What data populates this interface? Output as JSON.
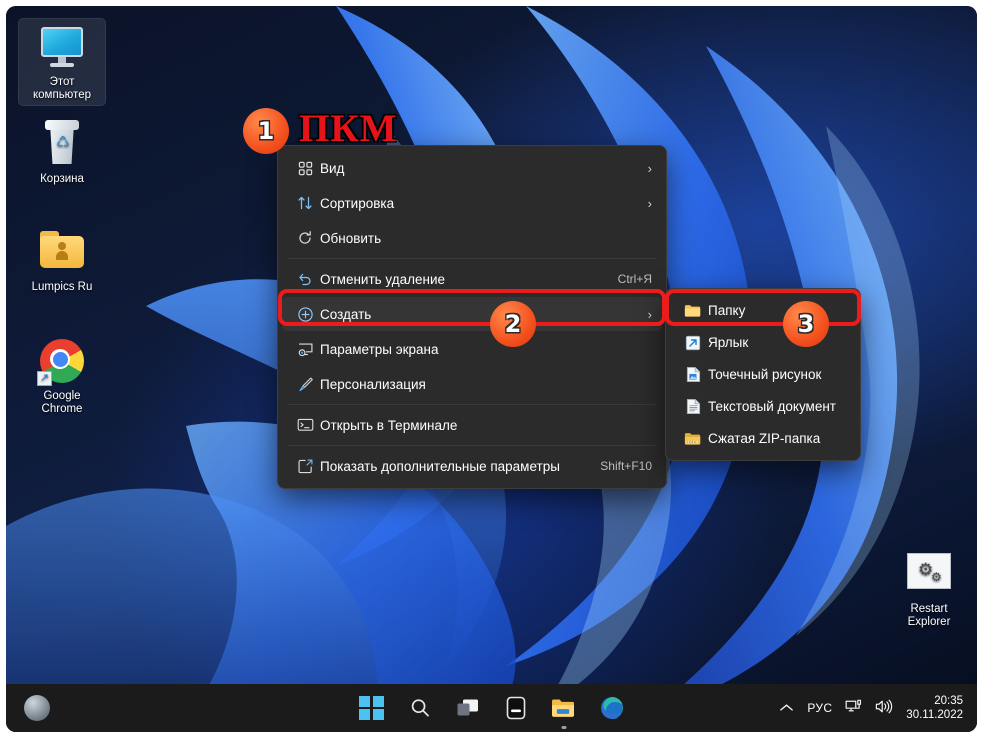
{
  "desktop": {
    "icons": [
      {
        "name": "this-pc",
        "label": "Этот\nкомпьютер",
        "selected": true
      },
      {
        "name": "recycle-bin",
        "label": "Корзина",
        "selected": false
      },
      {
        "name": "lumpics-folder",
        "label": "Lumpics Ru",
        "selected": false
      },
      {
        "name": "google-chrome",
        "label": "Google\nChrome",
        "selected": false
      },
      {
        "name": "restart-explorer",
        "label": "Restart\nExplorer",
        "selected": false
      }
    ]
  },
  "annotation": {
    "action_label": "ПКМ",
    "badge1": "1",
    "badge2": "2",
    "badge3": "3",
    "highlight_color": "#ec1c1c",
    "badge_color": "#f4511e"
  },
  "context_menu": {
    "items": [
      {
        "icon": "grid-view-icon",
        "label": "Вид",
        "accel": "",
        "submenu": true,
        "highlighted": false,
        "separator_after": false
      },
      {
        "icon": "sort-arrows-icon",
        "label": "Сортировка",
        "accel": "",
        "submenu": true,
        "highlighted": false,
        "separator_after": false
      },
      {
        "icon": "refresh-icon",
        "label": "Обновить",
        "accel": "",
        "submenu": false,
        "highlighted": false,
        "separator_after": true
      },
      {
        "icon": "undo-icon",
        "label": "Отменить удаление",
        "accel": "Ctrl+Я",
        "submenu": false,
        "highlighted": false,
        "separator_after": false
      },
      {
        "icon": "plus-circle-icon",
        "label": "Создать",
        "accel": "",
        "submenu": true,
        "highlighted": true,
        "separator_after": false
      },
      {
        "icon": "display-settings-icon",
        "label": "Параметры экрана",
        "accel": "",
        "submenu": false,
        "highlighted": false,
        "separator_after": false
      },
      {
        "icon": "brush-icon",
        "label": "Персонализация",
        "accel": "",
        "submenu": false,
        "highlighted": false,
        "separator_after": true
      },
      {
        "icon": "terminal-icon",
        "label": "Открыть в Терминале",
        "accel": "",
        "submenu": false,
        "highlighted": false,
        "separator_after": true
      },
      {
        "icon": "more-options-icon",
        "label": "Показать дополнительные параметры",
        "accel": "Shift+F10",
        "submenu": false,
        "highlighted": false,
        "separator_after": false
      }
    ]
  },
  "submenu": {
    "items": [
      {
        "icon": "folder-icon",
        "label": "Папку"
      },
      {
        "icon": "shortcut-arrow-icon",
        "label": "Ярлык"
      },
      {
        "icon": "bitmap-image-icon",
        "label": "Точечный рисунок"
      },
      {
        "icon": "text-document-icon",
        "label": "Текстовый документ"
      },
      {
        "icon": "zip-folder-icon",
        "label": "Сжатая ZIP-папка"
      }
    ]
  },
  "taskbar": {
    "weather_icon": "weather-icon",
    "center_icons": [
      {
        "name": "start-button",
        "label": "Пуск"
      },
      {
        "name": "search-icon",
        "label": "Поиск"
      },
      {
        "name": "task-view-icon",
        "label": "Представление задач"
      },
      {
        "name": "widgets-icon",
        "label": "Виджеты"
      },
      {
        "name": "file-explorer-icon",
        "label": "Проводник",
        "running": true
      },
      {
        "name": "microsoft-edge-icon",
        "label": "Microsoft Edge"
      }
    ],
    "tray": {
      "overflow_chevron": "⌃",
      "language": "РУС",
      "network_icon": "network-icon",
      "volume_icon": "volume-icon",
      "time": "20:35",
      "date": "30.11.2022"
    }
  }
}
